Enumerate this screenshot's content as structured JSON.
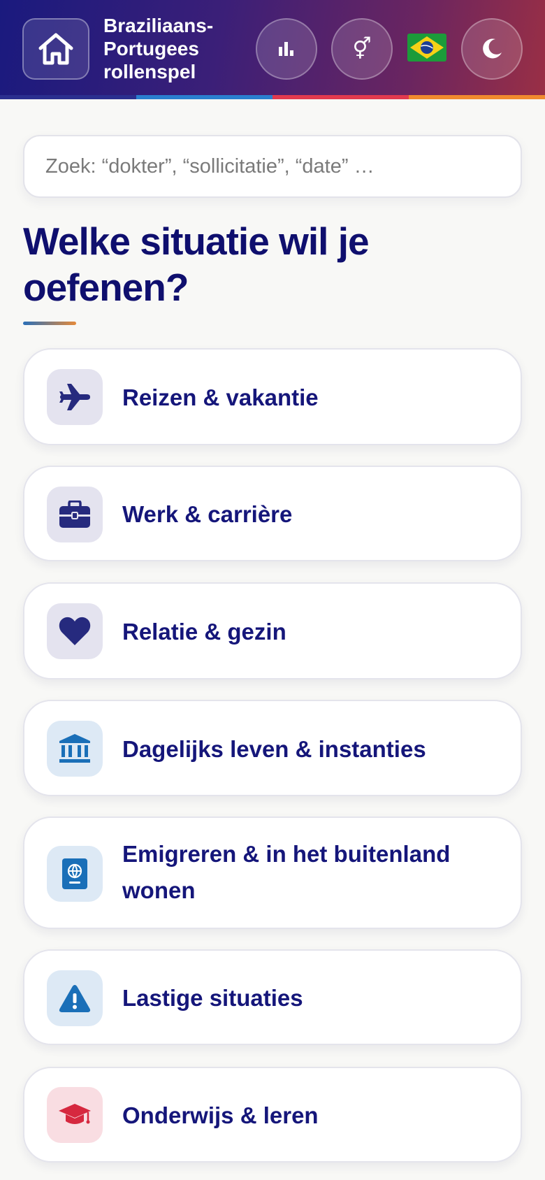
{
  "header": {
    "title_lines": [
      "Braziliaans-",
      "Portugees",
      "rollenspel"
    ],
    "gender_symbol": "⚥",
    "flag": "brazil-flag",
    "colors": {
      "gradient_start": "#1a1a7e",
      "gradient_end": "#9a2f45"
    }
  },
  "search": {
    "placeholder": "Zoek: “dokter”, “sollicitatie”, “date” …",
    "value": ""
  },
  "main": {
    "heading": "Welke situatie wil je oefenen?",
    "categories": [
      {
        "label": "Reizen & vakantie",
        "icon": "airplane-icon"
      },
      {
        "label": "Werk & carrière",
        "icon": "briefcase-icon"
      },
      {
        "label": "Relatie & gezin",
        "icon": "heart-icon"
      },
      {
        "label": "Dagelijks leven & instanties",
        "icon": "institution-icon"
      },
      {
        "label": "Emigreren & in het buitenland wonen",
        "icon": "passport-icon"
      },
      {
        "label": "Lastige situaties",
        "icon": "warning-icon"
      },
      {
        "label": "Onderwijs & leren",
        "icon": "graduation-cap-icon"
      }
    ]
  }
}
